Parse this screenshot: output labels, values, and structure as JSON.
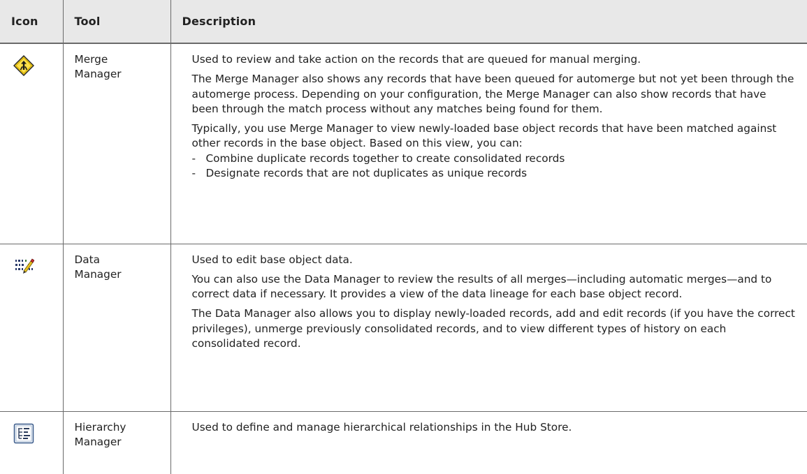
{
  "table": {
    "headers": {
      "icon": "Icon",
      "tool": "Tool",
      "description": "Description"
    },
    "rows": [
      {
        "icon": "merge-manager-icon",
        "tool_lines": [
          "Merge",
          "Manager"
        ],
        "paragraphs": [
          "Used to review and take action on the records that are queued for manual merging.",
          "The Merge Manager also shows any records that have been queued for automerge but not yet been through the automerge process. Depending on your configuration, the Merge Manager can also show records that have been through the match process without any matches being found for them.",
          "Typically, you use Merge Manager to view newly-loaded base object records that have been matched against other records in the base object. Based on this view, you can:"
        ],
        "list_marker": "-",
        "list_items": [
          "Combine duplicate records together to create consolidated records",
          "Designate records that are not duplicates as unique records"
        ]
      },
      {
        "icon": "data-manager-icon",
        "tool_lines": [
          "Data",
          "Manager"
        ],
        "paragraphs": [
          "Used to edit base object data.",
          "You can also use the Data Manager to review the results of all merges—including automatic merges—and to correct data if necessary. It provides a view of the data lineage for each base object record.",
          "The Data Manager also allows you to display newly-loaded records, add and edit records (if you have the correct privileges), unmerge previously consolidated records, and to view different types of history on each consolidated record."
        ]
      },
      {
        "icon": "hierarchy-manager-icon",
        "tool_lines": [
          "Hierarchy",
          "Manager"
        ],
        "paragraphs": [
          "Used to define and manage hierarchical relationships in the Hub Store."
        ]
      }
    ]
  }
}
